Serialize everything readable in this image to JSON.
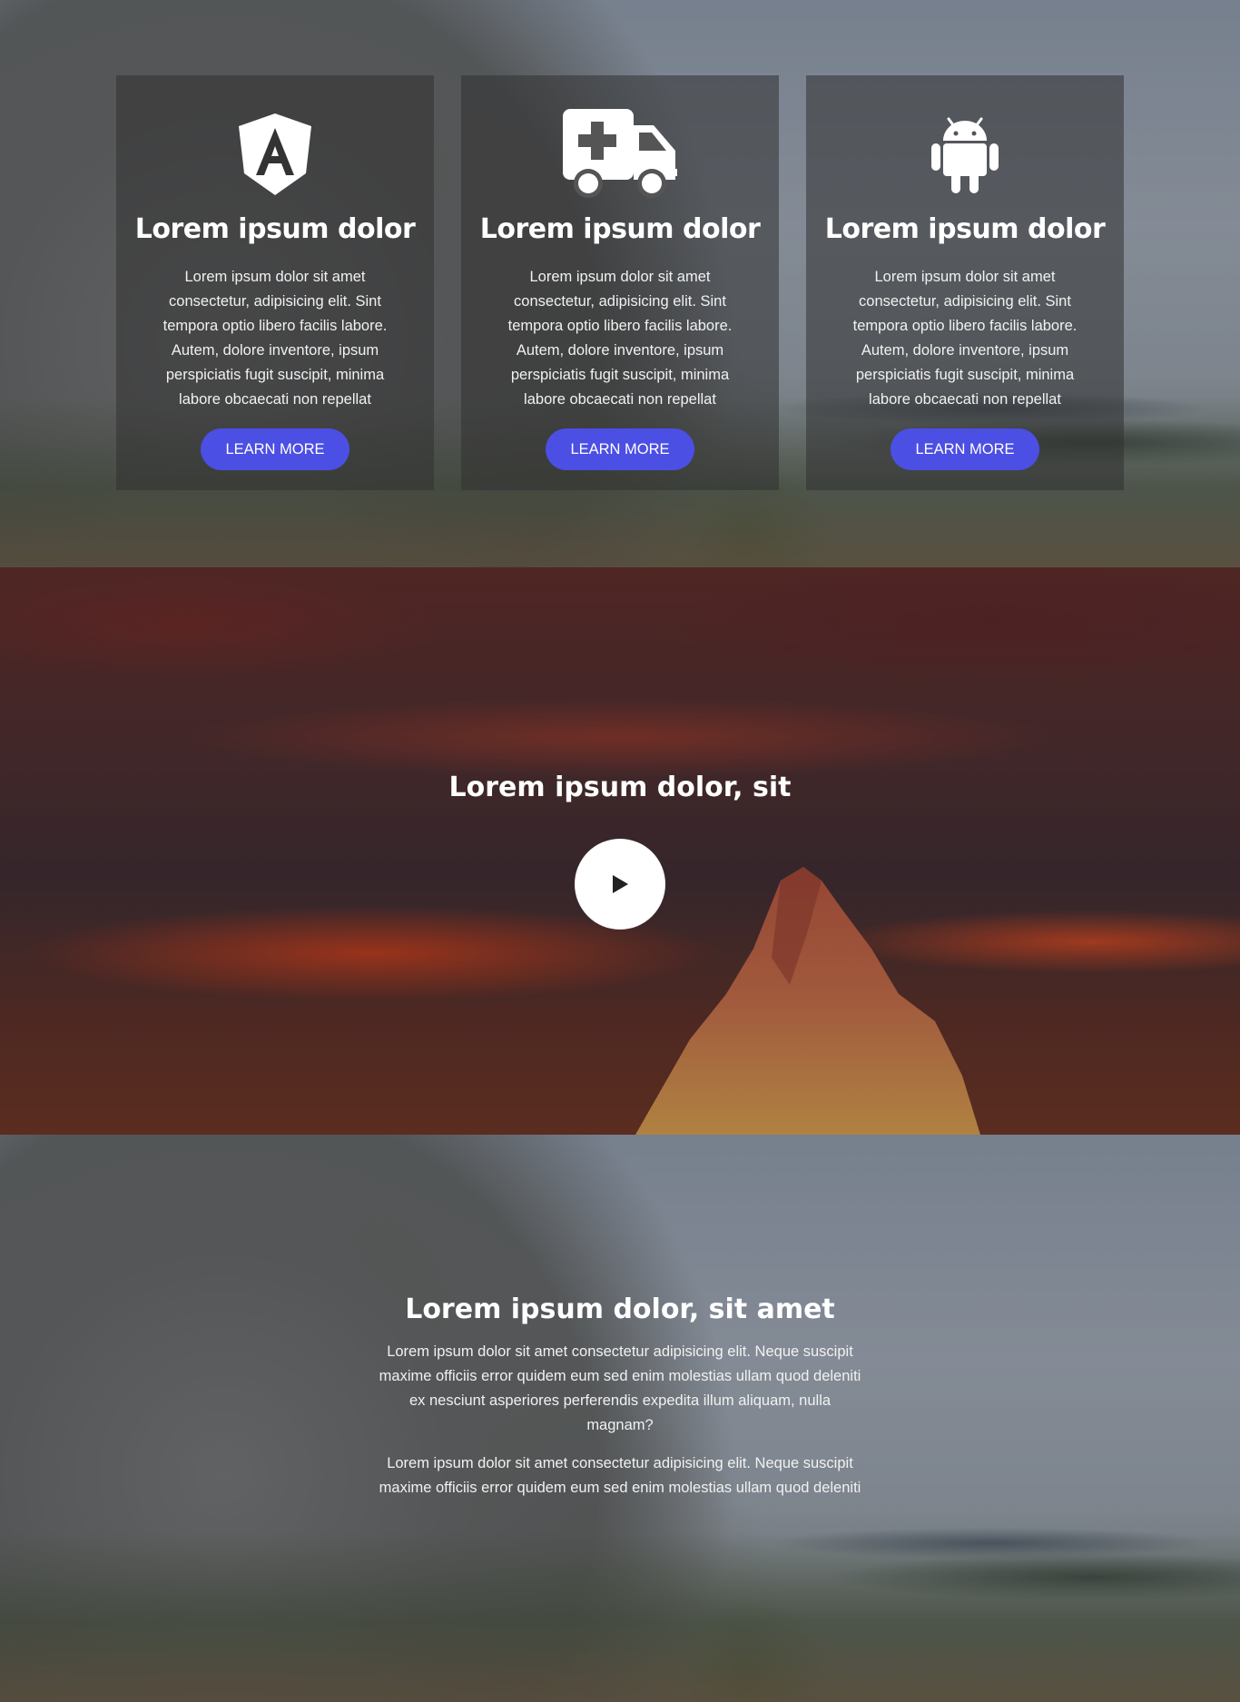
{
  "features": {
    "cards": [
      {
        "icon": "angular-icon",
        "title": "Lorem ipsum dolor",
        "text": "Lorem ipsum dolor sit amet consectetur, adipisicing elit. Sint tempora optio libero facilis labore. Autem, dolore inventore, ipsum perspiciatis fugit suscipit, minima labore obcaecati non repellat",
        "button_label": "LEARN MORE"
      },
      {
        "icon": "ambulance-icon",
        "title": "Lorem ipsum dolor",
        "text": "Lorem ipsum dolor sit amet consectetur, adipisicing elit. Sint tempora optio libero facilis labore. Autem, dolore inventore, ipsum perspiciatis fugit suscipit, minima labore obcaecati non repellat",
        "button_label": "LEARN MORE"
      },
      {
        "icon": "android-icon",
        "title": "Lorem ipsum dolor",
        "text": "Lorem ipsum dolor sit amet consectetur, adipisicing elit. Sint tempora optio libero facilis labore. Autem, dolore inventore, ipsum perspiciatis fugit suscipit, minima labore obcaecati non repellat",
        "button_label": "LEARN MORE"
      }
    ],
    "accent_color": "#4b4fe3"
  },
  "video": {
    "title": "Lorem ipsum dolor, sit",
    "play_icon": "play-icon"
  },
  "about": {
    "title": "Lorem ipsum dolor, sit amet",
    "paragraphs": [
      "Lorem ipsum dolor sit amet consectetur adipisicing elit. Neque suscipit maxime officiis error quidem eum sed enim molestias ullam quod deleniti ex nesciunt asperiores perferendis expedita illum aliquam, nulla magnam?",
      "Lorem ipsum dolor sit amet consectetur adipisicing elit. Neque suscipit maxime officiis error quidem eum sed enim molestias ullam quod deleniti"
    ]
  }
}
